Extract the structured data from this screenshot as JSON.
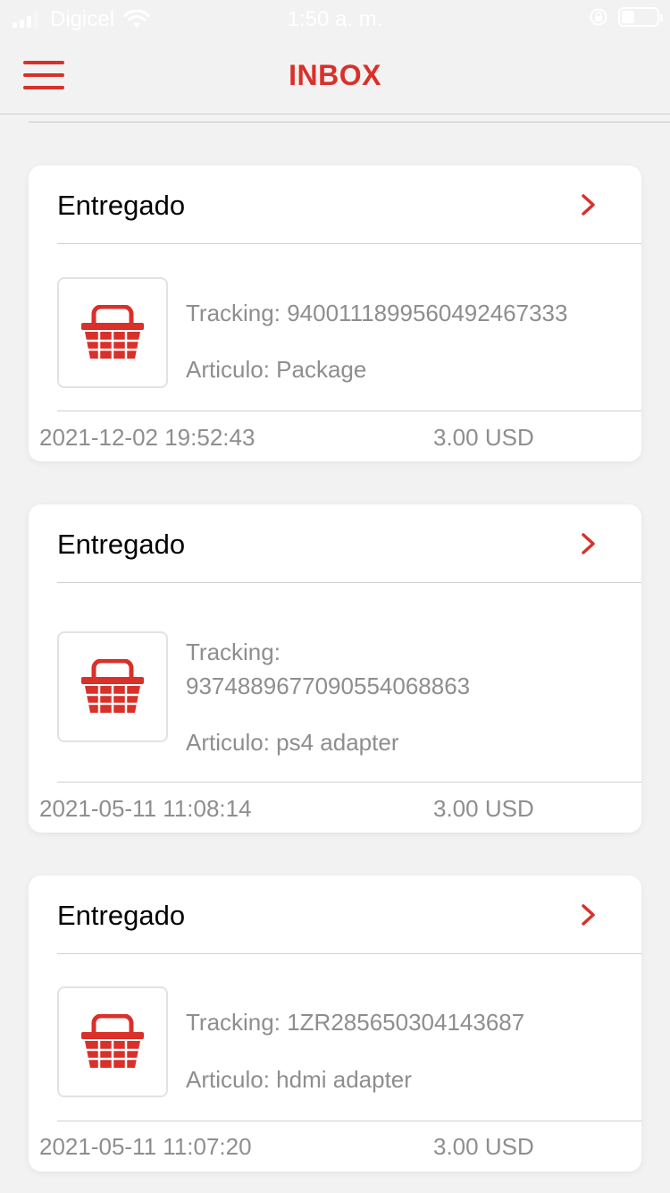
{
  "status_bar": {
    "carrier": "Digicel",
    "time": "1:50 a. m.",
    "icons": [
      "signal-icon",
      "wifi-icon",
      "orientation-lock-icon",
      "battery-icon"
    ]
  },
  "nav": {
    "title": "INBOX",
    "menu_icon": "hamburger-menu-icon"
  },
  "colors": {
    "accent": "#d9302a",
    "muted_text": "#8e8e8e",
    "background": "#f2f2f2",
    "card": "#ffffff"
  },
  "items": [
    {
      "status": "Entregado",
      "tracking_label": "Tracking:",
      "tracking": "9400111899560492467333",
      "article_label": "Articulo:",
      "article": "Package",
      "date": "2021-12-02 19:52:43",
      "amount": "3.00 USD",
      "icon": "basket-icon"
    },
    {
      "status": "Entregado",
      "tracking_label": "Tracking:",
      "tracking": "9374889677090554068863",
      "article_label": "Articulo:",
      "article": "ps4 adapter",
      "date": "2021-05-11 11:08:14",
      "amount": "3.00 USD",
      "icon": "basket-icon"
    },
    {
      "status": "Entregado",
      "tracking_label": "Tracking:",
      "tracking": "1ZR285650304143687",
      "article_label": "Articulo:",
      "article": "hdmi adapter",
      "date": "2021-05-11 11:07:20",
      "amount": "3.00 USD",
      "icon": "basket-icon"
    }
  ]
}
